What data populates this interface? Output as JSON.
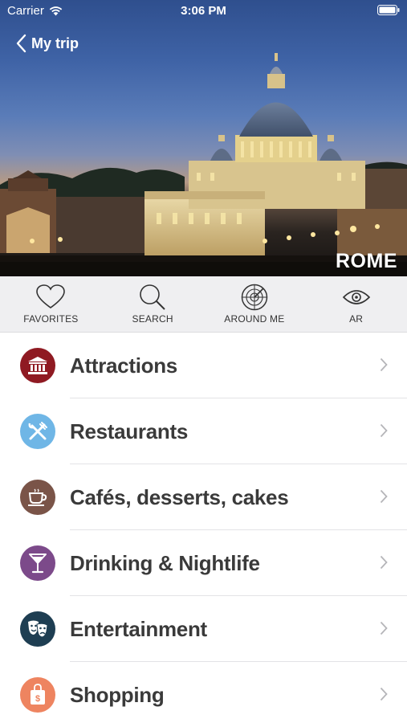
{
  "status_bar": {
    "carrier": "Carrier",
    "time": "3:06 PM"
  },
  "header": {
    "back_label": "My trip",
    "city": "ROME"
  },
  "toolbar": {
    "items": [
      {
        "label": "FAVORITES",
        "icon": "heart-icon"
      },
      {
        "label": "SEARCH",
        "icon": "search-icon"
      },
      {
        "label": "AROUND ME",
        "icon": "radar-icon"
      },
      {
        "label": "AR",
        "icon": "eye-icon"
      }
    ]
  },
  "categories": [
    {
      "label": "Attractions",
      "icon": "museum-icon",
      "color": "#8f1a22"
    },
    {
      "label": "Restaurants",
      "icon": "fork-knife-icon",
      "color": "#6fb6e6"
    },
    {
      "label": "Cafés, desserts, cakes",
      "icon": "coffee-cup-icon",
      "color": "#7a5448"
    },
    {
      "label": "Drinking & Nightlife",
      "icon": "cocktail-icon",
      "color": "#7c4a8a"
    },
    {
      "label": "Entertainment",
      "icon": "theater-masks-icon",
      "color": "#1e3e52"
    },
    {
      "label": "Shopping",
      "icon": "shopping-bag-icon",
      "color": "#ee8460"
    }
  ]
}
